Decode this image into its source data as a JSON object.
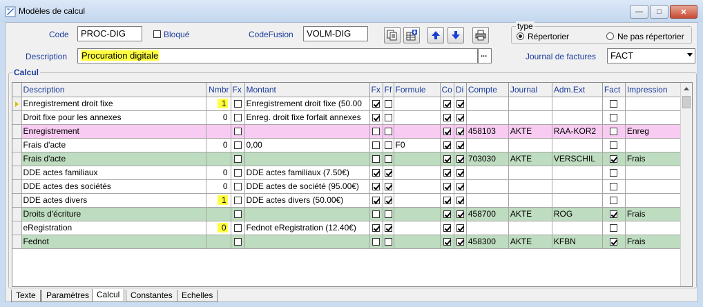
{
  "window": {
    "title": "Modèles de calcul",
    "minimize": "—",
    "maximize": "□",
    "close": "✕"
  },
  "form": {
    "code_label": "Code",
    "code_value": "PROC-DIG",
    "blocked_label": "Bloqué",
    "codefusion_label": "CodeFusion",
    "codefusion_value": "VOLM-DIG",
    "description_label": "Description",
    "description_value": "Procuration digitale",
    "ellipsis": "...",
    "journal_label": "Journal de factures",
    "journal_value": "FACT",
    "type_group": "type",
    "radio_repertorier": "Répertorier",
    "radio_ne_pas": "Ne pas répertorier"
  },
  "grid": {
    "group_title": "Calcul",
    "columns": [
      "Description",
      "Nmbr",
      "Fx",
      "Montant",
      "Fx",
      "Ff",
      "Formule",
      "Co",
      "Di",
      "Compte",
      "Journal",
      "Adm.Ext",
      "Fact",
      "Impression"
    ],
    "rows": [
      {
        "desc": "Enregistrement droit fixe",
        "nmbr": "1",
        "nmbr_hl": true,
        "montant": "Enregistrement droit fixe (50.00",
        "fx2": true,
        "ff": false,
        "formule": "",
        "co": true,
        "di": true,
        "compte": "",
        "journal": "",
        "adm": "",
        "fact": false,
        "impr": "",
        "style": "white",
        "current": true
      },
      {
        "desc": "Droit fixe pour les annexes",
        "nmbr": "0",
        "nmbr_hl": false,
        "montant": "Enreg. droit fixe forfait annexes",
        "fx2": true,
        "ff": false,
        "formule": "",
        "co": true,
        "di": true,
        "compte": "",
        "journal": "",
        "adm": "",
        "fact": false,
        "impr": "",
        "style": "white"
      },
      {
        "desc": "Enregistrement",
        "nmbr": "",
        "nmbr_hl": false,
        "montant": "",
        "fx2": false,
        "ff": false,
        "formule": "",
        "co": true,
        "di": true,
        "compte": "458103",
        "journal": "AKTE",
        "adm": "RAA-KOR2",
        "fact": false,
        "impr": "Enreg",
        "style": "pink"
      },
      {
        "desc": "Frais d'acte",
        "nmbr": "0",
        "nmbr_hl": false,
        "montant": "0,00",
        "fx2": false,
        "ff": false,
        "formule": "F0",
        "co": true,
        "di": true,
        "compte": "",
        "journal": "",
        "adm": "",
        "fact": false,
        "impr": "",
        "style": "white"
      },
      {
        "desc": "Frais d'acte",
        "nmbr": "",
        "nmbr_hl": false,
        "montant": "",
        "fx2": false,
        "ff": false,
        "formule": "",
        "co": true,
        "di": true,
        "compte": "703030",
        "journal": "AKTE",
        "adm": "VERSCHIL",
        "fact": true,
        "impr": "Frais",
        "style": "green"
      },
      {
        "desc": "DDE actes familiaux",
        "nmbr": "0",
        "nmbr_hl": false,
        "montant": "DDE actes familiaux (7.50€)",
        "fx2": true,
        "ff": true,
        "formule": "",
        "co": true,
        "di": true,
        "compte": "",
        "journal": "",
        "adm": "",
        "fact": false,
        "impr": "",
        "style": "white"
      },
      {
        "desc": "DDE actes des sociétés",
        "nmbr": "0",
        "nmbr_hl": false,
        "montant": "DDE actes de société (95.00€)",
        "fx2": true,
        "ff": true,
        "formule": "",
        "co": true,
        "di": true,
        "compte": "",
        "journal": "",
        "adm": "",
        "fact": false,
        "impr": "",
        "style": "white"
      },
      {
        "desc": "DDE actes divers",
        "nmbr": "1",
        "nmbr_hl": true,
        "montant": "DDE actes divers (50.00€)",
        "fx2": true,
        "ff": true,
        "formule": "",
        "co": true,
        "di": true,
        "compte": "",
        "journal": "",
        "adm": "",
        "fact": false,
        "impr": "",
        "style": "white"
      },
      {
        "desc": "Droits d'écriture",
        "nmbr": "",
        "nmbr_hl": false,
        "montant": "",
        "fx2": false,
        "ff": false,
        "formule": "",
        "co": true,
        "di": true,
        "compte": "458700",
        "journal": "AKTE",
        "adm": "ROG",
        "fact": true,
        "impr": "Frais",
        "style": "green"
      },
      {
        "desc": "eRegistration",
        "nmbr": "0",
        "nmbr_hl": true,
        "montant": "Fednot eRegistration (12.40€)",
        "fx2": true,
        "ff": true,
        "formule": "",
        "co": true,
        "di": true,
        "compte": "",
        "journal": "",
        "adm": "",
        "fact": false,
        "impr": "",
        "style": "white"
      },
      {
        "desc": "Fednot",
        "nmbr": "",
        "nmbr_hl": false,
        "montant": "",
        "fx2": false,
        "ff": false,
        "formule": "",
        "co": true,
        "di": true,
        "compte": "458300",
        "journal": "AKTE",
        "adm": "KFBN",
        "fact": true,
        "impr": "Frais",
        "style": "green"
      }
    ]
  },
  "tabs": [
    "Texte",
    "Paramètres",
    "Calcul",
    "Constantes",
    "Echelles"
  ],
  "active_tab": "Calcul",
  "colors": {
    "label_blue": "#1a3b9c",
    "highlight_yellow": "#ffff40",
    "row_pink": "#f8cbf2",
    "row_green": "#bedcbf"
  }
}
